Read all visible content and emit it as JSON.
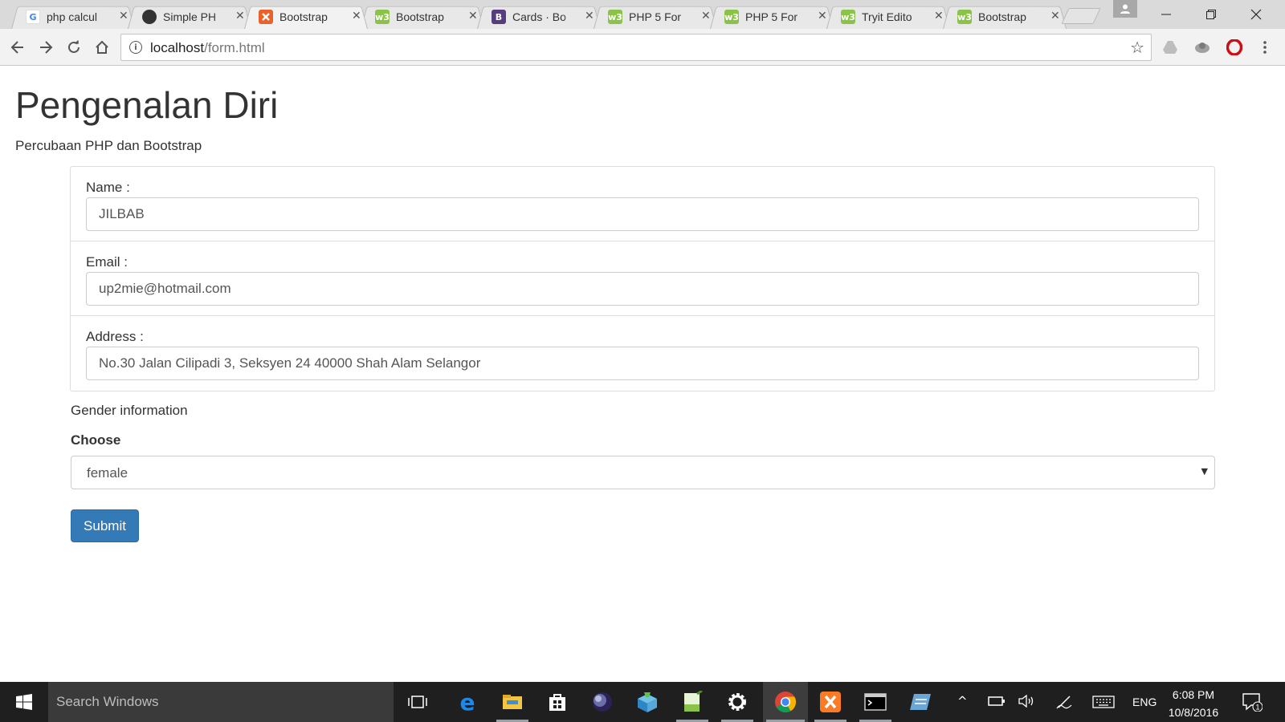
{
  "browser": {
    "tabs": [
      {
        "label": "php calcul",
        "icon": "google-icon",
        "icon_color": "#ffffff",
        "glyph": "G",
        "glyph_color": "#4285f4",
        "active": false
      },
      {
        "label": "Simple PH",
        "icon": "github-icon",
        "icon_color": "#333333",
        "glyph": "",
        "glyph_color": "#ffffff",
        "active": false
      },
      {
        "label": "Bootstrap",
        "icon": "xampp-icon",
        "icon_color": "#e8622a",
        "glyph": "",
        "glyph_color": "#ffffff",
        "active": true
      },
      {
        "label": "Bootstrap",
        "icon": "w3schools-icon",
        "icon_color": "#8bc34a",
        "glyph": "w3",
        "glyph_color": "#ffffff",
        "active": false
      },
      {
        "label": "Cards · Bo",
        "icon": "bootstrap-icon",
        "icon_color": "#563d7c",
        "glyph": "B",
        "glyph_color": "#ffffff",
        "active": false
      },
      {
        "label": "PHP 5 For",
        "icon": "w3schools-icon",
        "icon_color": "#8bc34a",
        "glyph": "w3",
        "glyph_color": "#ffffff",
        "active": false
      },
      {
        "label": "PHP 5 For",
        "icon": "w3schools-icon",
        "icon_color": "#8bc34a",
        "glyph": "w3",
        "glyph_color": "#ffffff",
        "active": false
      },
      {
        "label": "Tryit Edito",
        "icon": "w3schools-icon",
        "icon_color": "#8bc34a",
        "glyph": "w3",
        "glyph_color": "#ffffff",
        "active": false
      },
      {
        "label": "Bootstrap",
        "icon": "w3schools-icon",
        "icon_color": "#8bc34a",
        "glyph": "w3",
        "glyph_color": "#ffffff",
        "active": false
      }
    ],
    "url_host": "localhost",
    "url_path": "/form.html"
  },
  "page": {
    "title": "Pengenalan Diri",
    "subtitle": "Percubaan PHP dan Bootstrap",
    "fields": [
      {
        "label": "Name :",
        "value": "JILBAB"
      },
      {
        "label": "Email :",
        "value": "up2mie@hotmail.com"
      },
      {
        "label": "Address :",
        "value": "No.30 Jalan Cilipadi 3, Seksyen 24 40000 Shah Alam Selangor"
      }
    ],
    "gender_info": "Gender information",
    "choose_label": "Choose",
    "gender_selected": "female",
    "submit_label": "Submit",
    "accent_color": "#337ab7"
  },
  "taskbar": {
    "search_placeholder": "Search Windows",
    "language": "ENG",
    "time": "6:08 PM",
    "date": "10/8/2016",
    "notifications": "1"
  }
}
